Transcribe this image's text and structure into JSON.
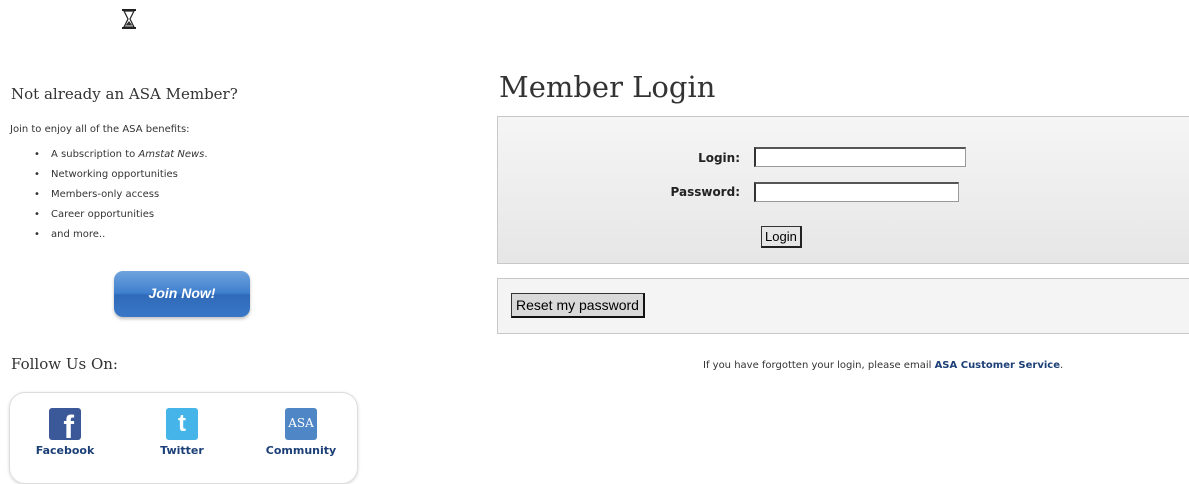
{
  "left": {
    "not_member_heading": "Not already an ASA Member?",
    "join_text": "Join to enjoy all of the ASA benefits:",
    "benefits": {
      "b1_prefix": "A subscription to ",
      "b1_em": "Amstat News",
      "b1_suffix": ".",
      "b2": "Networking opportunities",
      "b3": "Members-only access",
      "b4": "Career opportunities",
      "b5": "and more.."
    },
    "join_button": "Join Now!",
    "follow_heading": "Follow Us On:",
    "social": {
      "facebook": "Facebook",
      "twitter": "Twitter",
      "community": "Community",
      "community_icon_text": "ASA"
    }
  },
  "main": {
    "title": "Member Login",
    "login_label": "Login:",
    "password_label": "Password:",
    "login_value": "",
    "password_value": "",
    "login_button": "Login",
    "reset_button": "Reset my password",
    "forgot_text": "If you have forgotten your login, please email ",
    "forgot_link": "ASA Customer Service",
    "forgot_end": "."
  },
  "colors": {
    "link": "#1b3f76",
    "join_button": "#3f7fce",
    "facebook": "#3b5998",
    "twitter": "#45b4e8",
    "community": "#4f86c6"
  },
  "icons": [
    "hourglass-icon",
    "facebook-icon",
    "twitter-icon",
    "asa-community-icon"
  ]
}
